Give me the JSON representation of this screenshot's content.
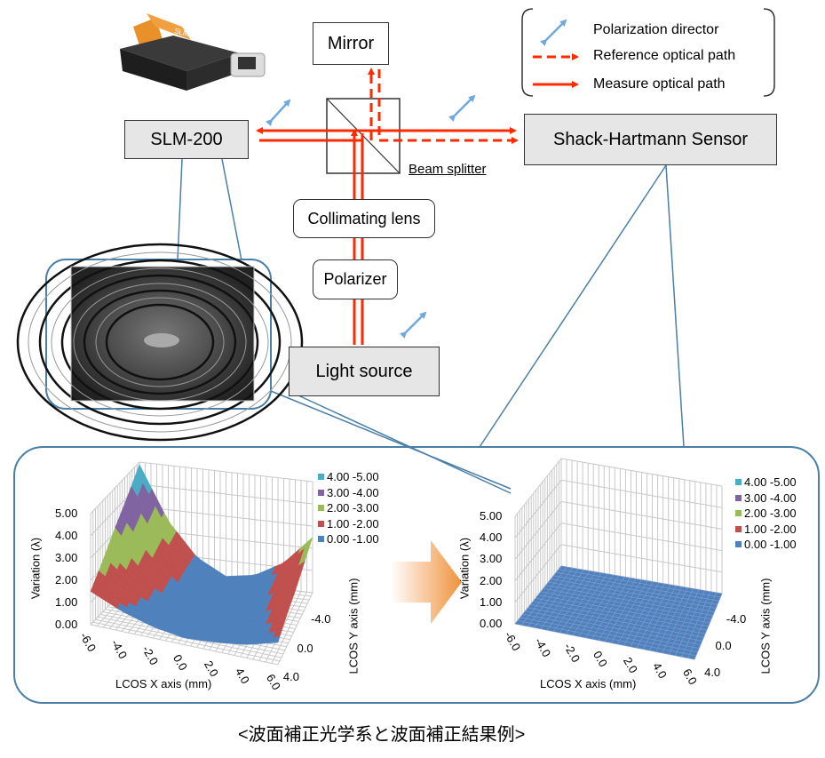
{
  "labels": {
    "mirror": "Mirror",
    "slm": "SLM-200",
    "beam_splitter": "Beam splitter",
    "shack_hartmann": "Shack-Hartmann Sensor",
    "collimating_lens": "Collimating lens",
    "polarizer": "Polarizer",
    "light_source": "Light source",
    "caption": "<波面補正光学系と波面補正結果例>"
  },
  "device_logo": "SLM-200",
  "legend": {
    "polarization": "Polarization director",
    "reference": "Reference optical path",
    "measure": "Measure optical path"
  },
  "colors": {
    "beam": "#ff2a00",
    "polarization_arrow": "#6fa8dc",
    "callout": "#4a7fa7",
    "arrow_orange": "#f0923a"
  },
  "chart_data": [
    {
      "type": "surface",
      "xlabel": "LCOS X axis (mm)",
      "ylabel": "LCOS Y axis (mm)",
      "zlabel": "Variation (λ)",
      "x_ticks": [
        "-6.0",
        "-4.0",
        "-2.0",
        "0.0",
        "2.0",
        "4.0",
        "6.0"
      ],
      "y_ticks": [
        "-4.0",
        "0.0",
        "4.0"
      ],
      "z_ticks": [
        "0.00",
        "1.00",
        "2.00",
        "3.00",
        "4.00",
        "5.00"
      ],
      "zlim": [
        0,
        5
      ],
      "legend_position": "right",
      "bands": [
        {
          "label": "4.00 -5.00",
          "color": "#4bacc6"
        },
        {
          "label": "3.00 -4.00",
          "color": "#8064a2"
        },
        {
          "label": "2.00 -3.00",
          "color": "#9bbb59"
        },
        {
          "label": "1.00 -2.00",
          "color": "#c0504d"
        },
        {
          "label": "0.00 -1.00",
          "color": "#4f81bd"
        }
      ],
      "x": [
        -6,
        -4,
        -2,
        0,
        2,
        4,
        6
      ],
      "y": [
        -4,
        -2,
        0,
        2,
        4
      ],
      "z": [
        [
          4.9,
          2.5,
          1.0,
          0.3,
          0.5,
          1.2,
          2.5
        ],
        [
          4.0,
          2.1,
          0.9,
          0.3,
          0.4,
          1.0,
          2.1
        ],
        [
          3.2,
          1.7,
          0.7,
          0.3,
          0.4,
          0.9,
          1.7
        ],
        [
          2.3,
          1.3,
          0.6,
          0.3,
          0.4,
          0.7,
          1.4
        ],
        [
          1.5,
          0.9,
          0.5,
          0.3,
          0.4,
          0.6,
          1.0
        ]
      ]
    },
    {
      "type": "surface",
      "xlabel": "LCOS X axis (mm)",
      "ylabel": "LCOS Y axis (mm)",
      "zlabel": "Variation (λ)",
      "x_ticks": [
        "-6.0",
        "-4.0",
        "-2.0",
        "0.0",
        "2.0",
        "4.0",
        "6.0"
      ],
      "y_ticks": [
        "-4.0",
        "0.0",
        "4.0"
      ],
      "z_ticks": [
        "0.00",
        "1.00",
        "2.00",
        "3.00",
        "4.00",
        "5.00"
      ],
      "zlim": [
        0,
        5
      ],
      "legend_position": "right",
      "bands": [
        {
          "label": "4.00 -5.00",
          "color": "#4bacc6"
        },
        {
          "label": "3.00 -4.00",
          "color": "#8064a2"
        },
        {
          "label": "2.00 -3.00",
          "color": "#9bbb59"
        },
        {
          "label": "1.00 -2.00",
          "color": "#c0504d"
        },
        {
          "label": "0.00 -1.00",
          "color": "#4f81bd"
        }
      ],
      "x": [
        -6,
        -4,
        -2,
        0,
        2,
        4,
        6
      ],
      "y": [
        -4,
        -2,
        0,
        2,
        4
      ],
      "z": [
        [
          0,
          0,
          0,
          0,
          0,
          0,
          0
        ],
        [
          0,
          0,
          0,
          0,
          0,
          0,
          0
        ],
        [
          0,
          0,
          0,
          0,
          0,
          0,
          0
        ],
        [
          0,
          0,
          0,
          0,
          0,
          0,
          0
        ],
        [
          0,
          0,
          0,
          0,
          0,
          0,
          0
        ]
      ]
    }
  ]
}
